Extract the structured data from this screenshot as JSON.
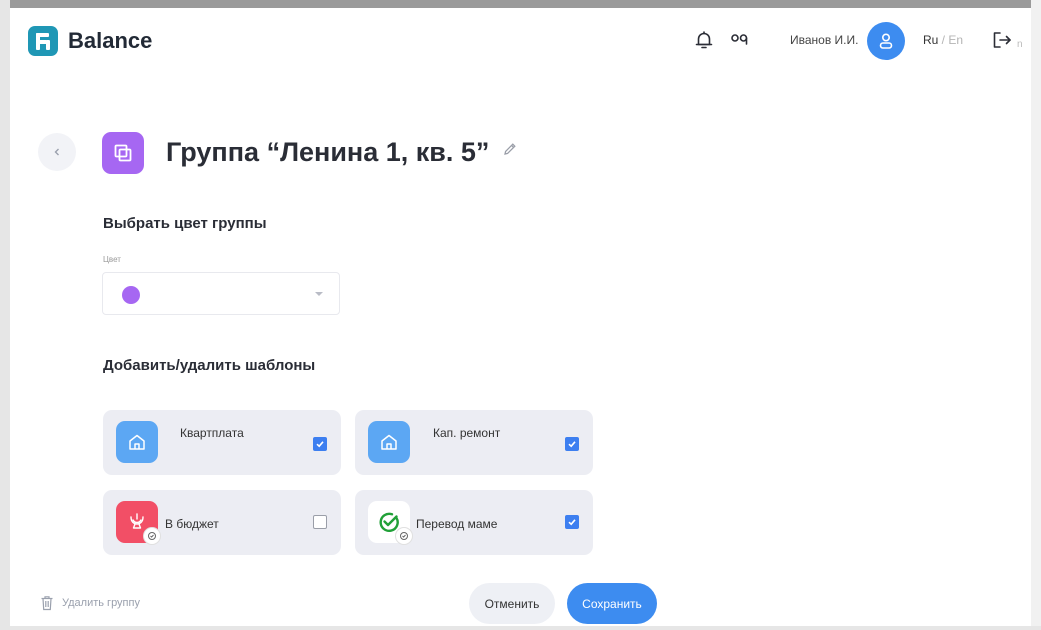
{
  "header": {
    "app_name": "Balance",
    "user_name": "Иванов И.И.",
    "lang_active": "Ru",
    "lang_separator": " / ",
    "lang_inactive": "En",
    "logout_suffix": "n"
  },
  "page": {
    "title": "Группа “Ленина 1, кв. 5”",
    "color_section_title": "Выбрать цвет группы",
    "color_field_label": "Цвет",
    "selected_color": "#a667f2",
    "templates_section_title": "Добавить/удалить шаблоны"
  },
  "templates": [
    {
      "label": "Квартплата",
      "icon": "house-icon",
      "checked": true
    },
    {
      "label": "Кап. ремонт",
      "icon": "house-icon",
      "checked": true
    },
    {
      "label": "В бюджет",
      "icon": "budget-emblem-icon",
      "checked": false
    },
    {
      "label": "Перевод маме",
      "icon": "sber-logo-icon",
      "checked": true
    }
  ],
  "footer": {
    "delete_label": "Удалить группу",
    "cancel_label": "Отменить",
    "save_label": "Сохранить"
  },
  "colors": {
    "accent": "#3d8cf0",
    "group_purple": "#a667f2",
    "logo_teal": "#1f97b5",
    "card_bg": "#ecedf3"
  }
}
